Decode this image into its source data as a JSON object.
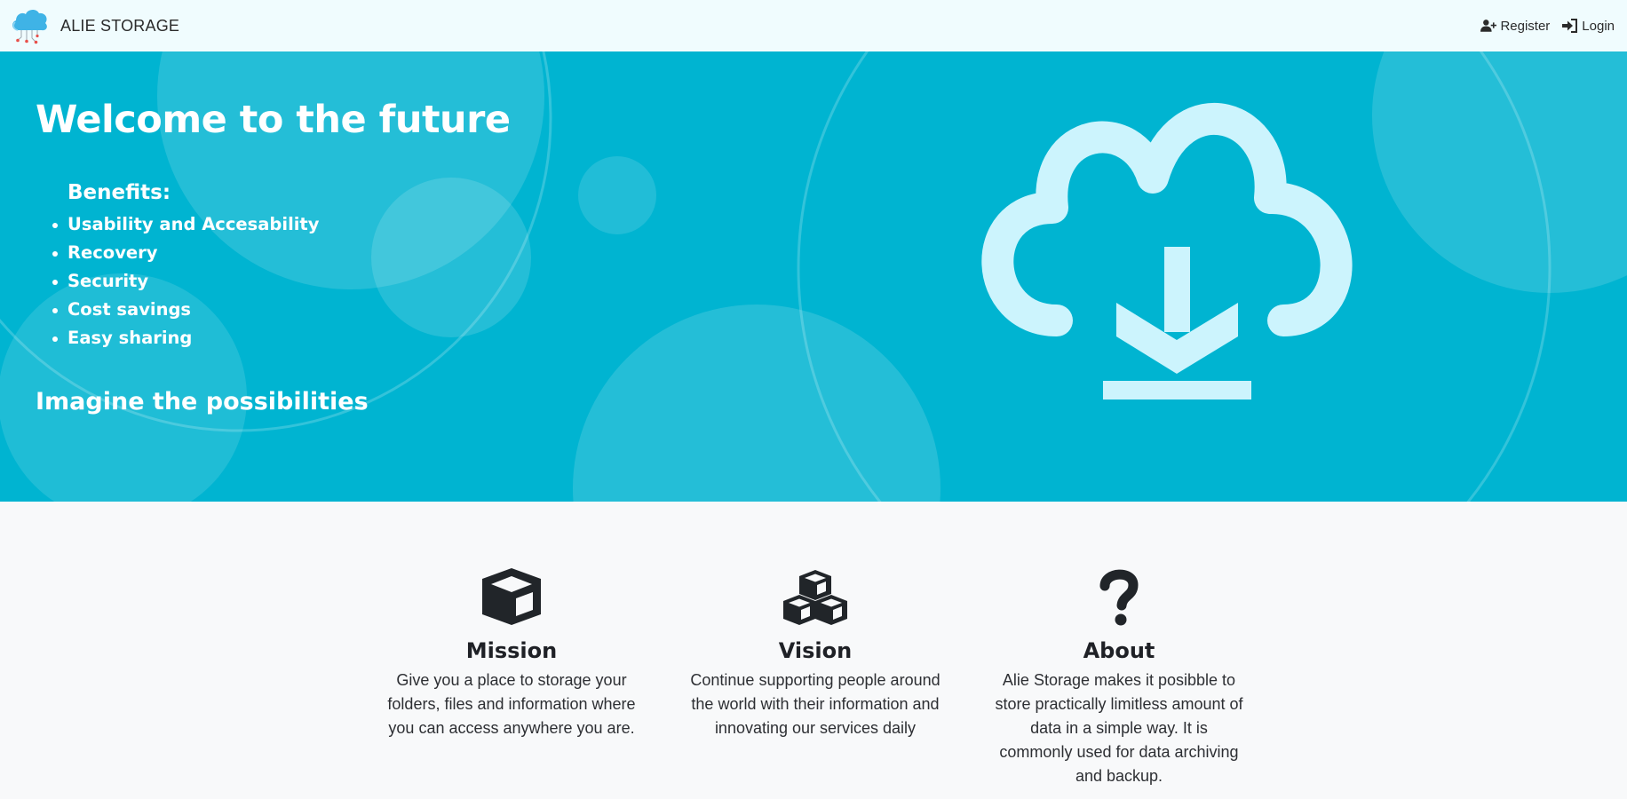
{
  "navbar": {
    "brand": "ALIE STORAGE",
    "register_label": "Register",
    "login_label": "Login"
  },
  "hero": {
    "title": "Welcome to the future",
    "benefits_heading": "Benefits:",
    "benefits": [
      "Usability and Accesability",
      "Recovery",
      "Security",
      "Cost savings",
      "Easy sharing"
    ],
    "subtitle": "Imagine the possibilities"
  },
  "features": [
    {
      "icon": "box-icon",
      "title": "Mission",
      "text": "Give you a place to storage your folders, files and information where you can access anywhere you are."
    },
    {
      "icon": "cubes-icon",
      "title": "Vision",
      "text": "Continue supporting people around the world with their information and innovating our services daily"
    },
    {
      "icon": "question-icon",
      "title": "About",
      "text": "Alie Storage makes it posibble to store practically limitless amount of data in a simple way. It is commonly used for data archiving and backup."
    }
  ],
  "colors": {
    "hero_background": "#00b4d1",
    "navbar_background": "#f0fcfe",
    "cloud_icon": "#ccf4fd",
    "page_background": "#f8f9fa"
  }
}
